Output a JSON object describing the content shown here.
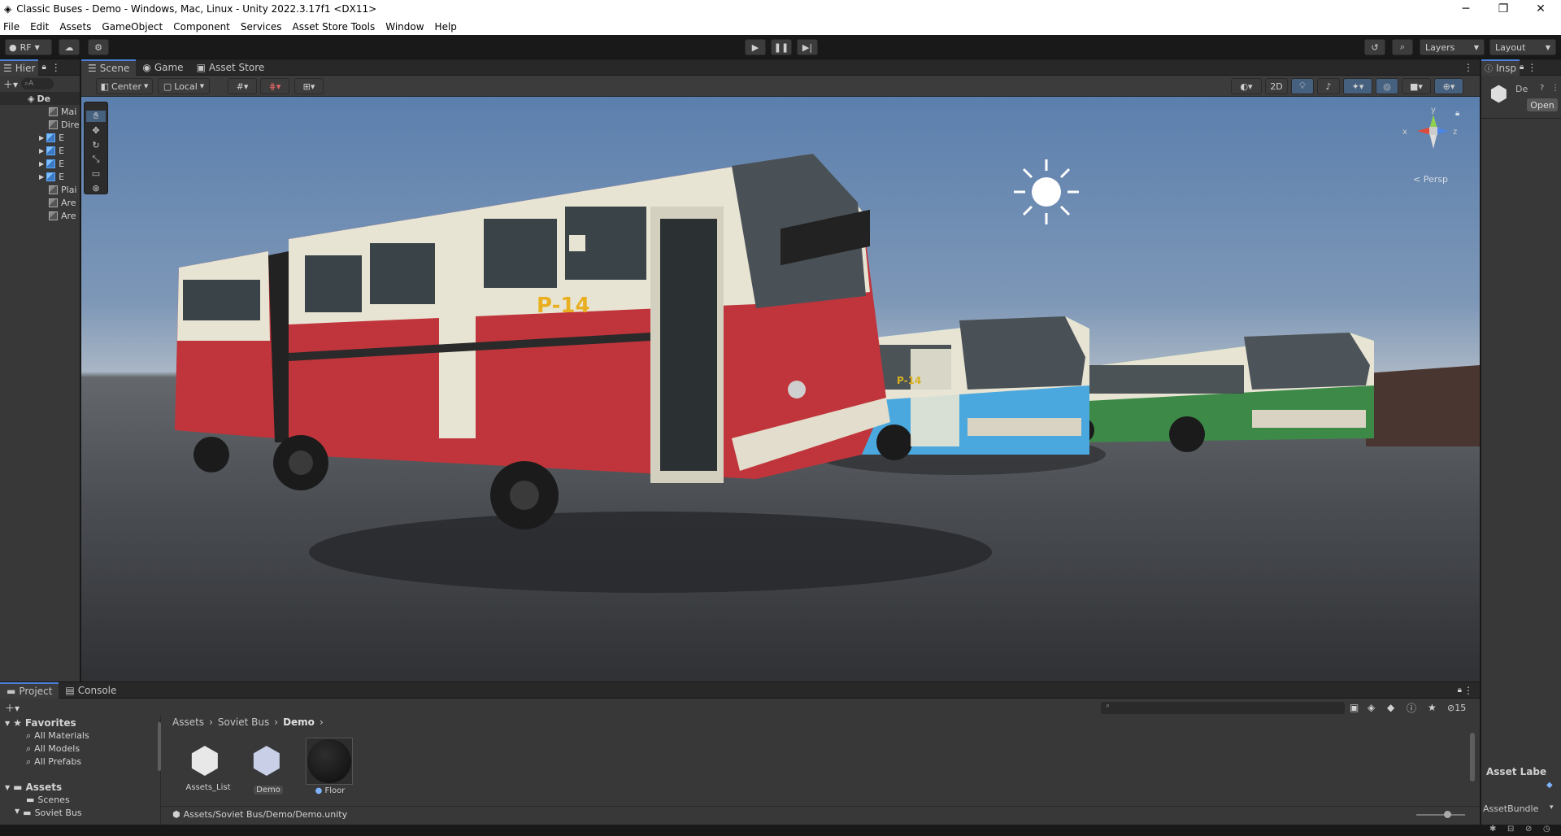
{
  "window": {
    "title": "Classic Buses - Demo - Windows, Mac, Linux - Unity 2022.3.17f1 <DX11>",
    "minimize": "─",
    "maximize": "❐",
    "close": "✕"
  },
  "menu": [
    "File",
    "Edit",
    "Assets",
    "GameObject",
    "Component",
    "Services",
    "Asset Store Tools",
    "Window",
    "Help"
  ],
  "toolbar": {
    "account_label": "RF",
    "layers_label": "Layers",
    "layout_label": "Layout"
  },
  "hierarchy": {
    "tab_label": "Hier",
    "search_placeholder": "A",
    "items": [
      {
        "label": "De"
      },
      {
        "label": "Mai"
      },
      {
        "label": "Dire"
      },
      {
        "label": "E"
      },
      {
        "label": "E"
      },
      {
        "label": "E"
      },
      {
        "label": "E"
      },
      {
        "label": "Plai"
      },
      {
        "label": "Are"
      },
      {
        "label": "Are"
      }
    ]
  },
  "scene": {
    "tabs": [
      "Scene",
      "Game",
      "Asset Store"
    ],
    "pivot_label": "Center",
    "space_label": "Local",
    "mode_2d_label": "2D",
    "persp_label": "< Persp",
    "gizmo_y": "y",
    "gizmo_x": "x",
    "gizmo_z": "z",
    "bus_number": "P-14",
    "bus_number_small": "P-14"
  },
  "inspector": {
    "tab_label": "Insp",
    "object_label": "De",
    "open_label": "Open"
  },
  "project": {
    "tabs": [
      "Project",
      "Console"
    ],
    "favorites_label": "Favorites",
    "favorites": [
      "All Materials",
      "All Models",
      "All Prefabs"
    ],
    "assets_label": "Assets",
    "folders": [
      "Scenes",
      "Soviet Bus"
    ],
    "breadcrumb": [
      "Assets",
      "Soviet Bus",
      "Demo"
    ],
    "items": [
      {
        "label": "Assets_List"
      },
      {
        "label": "Demo"
      },
      {
        "label": "Floor"
      }
    ],
    "path": "Assets/Soviet Bus/Demo/Demo.unity",
    "hidden_count": "15"
  },
  "asset_labels": {
    "title": "Asset Labe",
    "bundle_label": "AssetBundle"
  },
  "colors": {
    "accent": "#4c7fd8",
    "bus_red": "#c0353b",
    "bus_blue": "#4aa8de",
    "bus_green": "#3d8a48",
    "bus_cream": "#e8e4d4"
  }
}
